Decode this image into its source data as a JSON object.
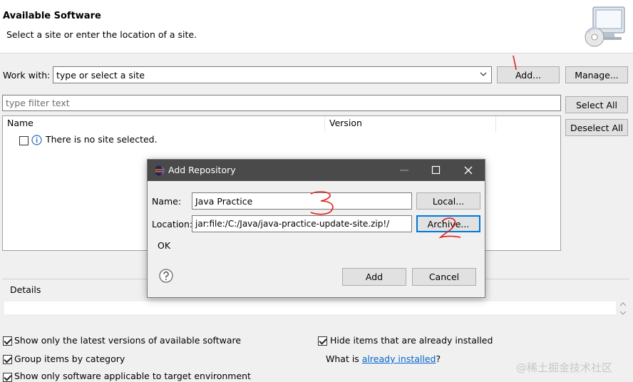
{
  "header": {
    "title": "Available Software",
    "subtitle": "Select a site or enter the location of a site."
  },
  "work_with": {
    "label": "Work with:",
    "value": "type or select a site",
    "add_label": "Add...",
    "manage_label": "Manage..."
  },
  "filter": {
    "placeholder": "type filter text",
    "select_all_label": "Select All",
    "deselect_all_label": "Deselect All"
  },
  "table": {
    "columns": [
      "Name",
      "Version"
    ],
    "empty_message": "There is no site selected."
  },
  "details": {
    "label": "Details"
  },
  "options": {
    "show_latest": "Show only the latest versions of available software",
    "group_by_category": "Group items by category",
    "show_applicable": "Show only software applicable to target environment",
    "hide_installed": "Hide items that are already installed",
    "what_is_prefix": "What is ",
    "what_is_link": "already installed",
    "what_is_suffix": "?"
  },
  "dialog": {
    "title": "Add Repository",
    "name_label": "Name:",
    "name_value": "Java Practice",
    "location_label": "Location:",
    "location_value": "jar:file:/C:/Java/java-practice-update-site.zip!/",
    "local_label": "Local...",
    "archive_label": "Archive...",
    "status": "OK",
    "add_label": "Add",
    "cancel_label": "Cancel"
  },
  "annotations": {
    "step1": "1",
    "step2": "2",
    "step3": "3",
    "color": "#e0201c"
  },
  "watermark": "@稀土掘金技术社区",
  "colors": {
    "dialog_titlebar": "#4a4a4a",
    "link": "#0066cc",
    "default_button_border": "#0078d7"
  }
}
